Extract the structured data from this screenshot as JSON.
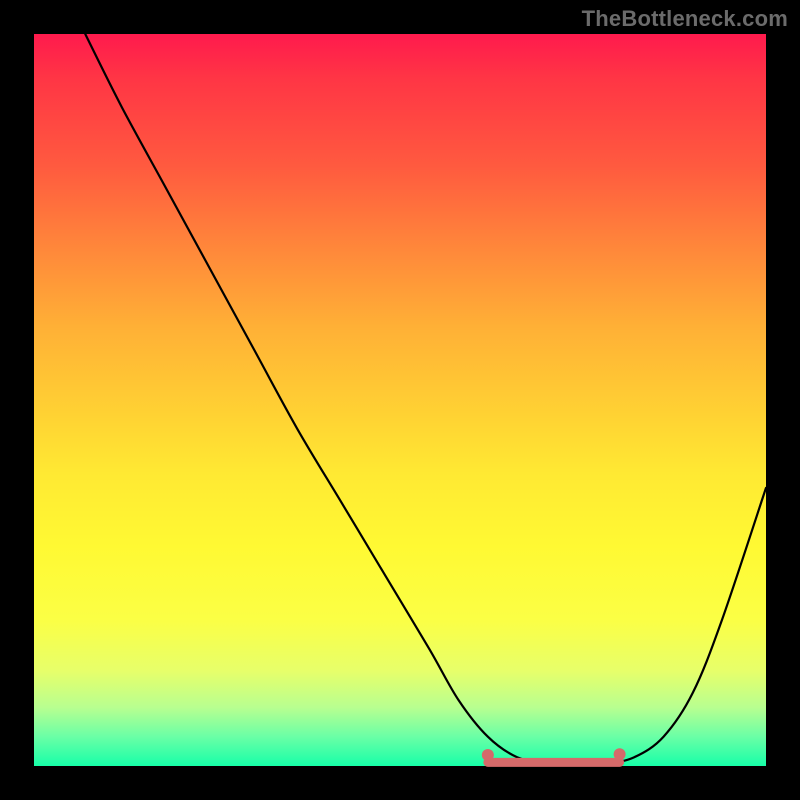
{
  "watermark": "TheBottleneck.com",
  "colors": {
    "background": "#000000",
    "curve_stroke": "#000000",
    "flat_segment": "#d56a6a",
    "flat_dot": "#d56a6a"
  },
  "chart_data": {
    "type": "line",
    "title": "",
    "xlabel": "",
    "ylabel": "",
    "xlim": [
      0,
      100
    ],
    "ylim": [
      0,
      100
    ],
    "grid": false,
    "legend": false,
    "series": [
      {
        "name": "curve",
        "x": [
          7,
          12,
          18,
          24,
          30,
          36,
          42,
          48,
          54,
          58,
          62,
          66,
          70,
          74,
          78,
          82,
          86,
          90,
          94,
          100
        ],
        "values": [
          100,
          90,
          79,
          68,
          57,
          46,
          36,
          26,
          16,
          9,
          4,
          1.2,
          0.4,
          0.2,
          0.3,
          1.2,
          4,
          10,
          20,
          38
        ]
      }
    ],
    "flat_segment": {
      "x_start": 62,
      "x_end": 80,
      "y": 0.5
    },
    "flat_dots": [
      {
        "x": 62,
        "y": 1.5
      },
      {
        "x": 80,
        "y": 1.6
      }
    ],
    "background_gradient": [
      [
        "#ff1a4d",
        0
      ],
      [
        "#ff3545",
        6
      ],
      [
        "#ff5a3f",
        18
      ],
      [
        "#ff8a3a",
        30
      ],
      [
        "#ffb036",
        40
      ],
      [
        "#ffd233",
        52
      ],
      [
        "#ffe933",
        60
      ],
      [
        "#fff933",
        70
      ],
      [
        "#fbff45",
        80
      ],
      [
        "#e7ff6a",
        87
      ],
      [
        "#b8ff90",
        92
      ],
      [
        "#6affa6",
        96
      ],
      [
        "#17ffa8",
        100
      ]
    ]
  }
}
